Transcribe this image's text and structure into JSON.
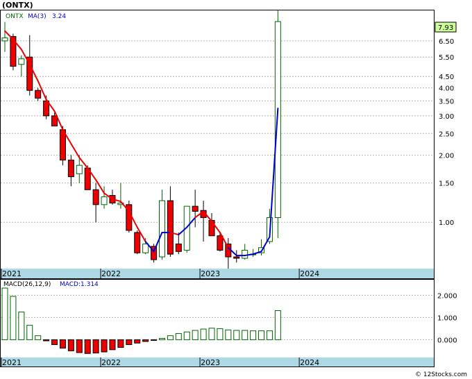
{
  "title": "(ONTX)",
  "watermark": "© 12Stocks.com",
  "price_panel": {
    "ticker_label": "ONTX",
    "ma_label": "MA(3)",
    "ma_value": "3.24",
    "last_price": "7.93"
  },
  "macd_panel": {
    "label": "MACD(26,12,9)",
    "value_label": "MACD:1.314"
  },
  "colors": {
    "up_candle": "#ffffff",
    "up_stroke": "#006400",
    "down_candle": "#ee0000",
    "ma_down": "#ee0000",
    "ma_up": "#0000cc",
    "macd_pos": "#006400",
    "macd_neg": "#ee0000",
    "axis_band": "#add8e6",
    "last_price_box": "#ccff99"
  },
  "chart_data": [
    {
      "type": "candlestick",
      "scale": "log",
      "ylim": [
        0.62,
        8.9
      ],
      "y_ticks": [
        "6.50",
        "5.50",
        "4.50",
        "4.00",
        "3.50",
        "3.00",
        "2.50",
        "2.00",
        "1.50",
        "1.00"
      ],
      "x_tick_labels": [
        "2021",
        "2022",
        "2023",
        "2024"
      ],
      "x_tick_positions": [
        0,
        12,
        24,
        36
      ],
      "candles": [
        {
          "o": 6.5,
          "h": 7.9,
          "l": 5.8,
          "c": 6.7
        },
        {
          "o": 6.8,
          "h": 7.0,
          "l": 4.8,
          "c": 5.0
        },
        {
          "o": 5.1,
          "h": 5.6,
          "l": 4.5,
          "c": 5.4
        },
        {
          "o": 5.5,
          "h": 6.9,
          "l": 3.7,
          "c": 3.9
        },
        {
          "o": 3.9,
          "h": 4.0,
          "l": 3.5,
          "c": 3.6
        },
        {
          "o": 3.5,
          "h": 3.7,
          "l": 2.9,
          "c": 3.0
        },
        {
          "o": 3.0,
          "h": 3.1,
          "l": 2.7,
          "c": 2.7
        },
        {
          "o": 2.6,
          "h": 2.7,
          "l": 1.8,
          "c": 1.9
        },
        {
          "o": 1.9,
          "h": 2.0,
          "l": 1.45,
          "c": 1.6
        },
        {
          "o": 1.65,
          "h": 2.0,
          "l": 1.5,
          "c": 1.8
        },
        {
          "o": 1.75,
          "h": 1.8,
          "l": 1.4,
          "c": 1.4
        },
        {
          "o": 1.4,
          "h": 1.5,
          "l": 1.0,
          "c": 1.2
        },
        {
          "o": 1.2,
          "h": 1.45,
          "l": 1.15,
          "c": 1.3
        },
        {
          "o": 1.32,
          "h": 1.4,
          "l": 1.2,
          "c": 1.22
        },
        {
          "o": 1.2,
          "h": 1.5,
          "l": 1.15,
          "c": 1.22
        },
        {
          "o": 1.2,
          "h": 1.25,
          "l": 0.9,
          "c": 0.92
        },
        {
          "o": 0.9,
          "h": 0.92,
          "l": 0.72,
          "c": 0.73
        },
        {
          "o": 0.73,
          "h": 0.85,
          "l": 0.72,
          "c": 0.8
        },
        {
          "o": 0.78,
          "h": 0.8,
          "l": 0.66,
          "c": 0.68
        },
        {
          "o": 0.7,
          "h": 1.4,
          "l": 0.68,
          "c": 1.25
        },
        {
          "o": 1.25,
          "h": 1.45,
          "l": 0.7,
          "c": 0.72
        },
        {
          "o": 0.8,
          "h": 0.9,
          "l": 0.72,
          "c": 0.74
        },
        {
          "o": 0.75,
          "h": 1.05,
          "l": 0.73,
          "c": 1.18
        },
        {
          "o": 1.18,
          "h": 1.4,
          "l": 0.95,
          "c": 1.12
        },
        {
          "o": 1.13,
          "h": 1.25,
          "l": 0.82,
          "c": 1.05
        },
        {
          "o": 1.02,
          "h": 1.1,
          "l": 0.88,
          "c": 0.87
        },
        {
          "o": 0.87,
          "h": 0.9,
          "l": 0.74,
          "c": 0.75
        },
        {
          "o": 0.8,
          "h": 0.85,
          "l": 0.62,
          "c": 0.7
        },
        {
          "o": 0.7,
          "h": 0.75,
          "l": 0.66,
          "c": 0.69
        },
        {
          "o": 0.69,
          "h": 0.8,
          "l": 0.68,
          "c": 0.75
        },
        {
          "o": 0.72,
          "h": 0.76,
          "l": 0.7,
          "c": 0.72
        },
        {
          "o": 0.73,
          "h": 0.84,
          "l": 0.71,
          "c": 0.77
        },
        {
          "o": 0.82,
          "h": 1.15,
          "l": 0.8,
          "c": 1.05
        },
        {
          "o": 1.05,
          "h": 8.9,
          "l": 0.85,
          "c": 7.93
        }
      ],
      "ma": [
        7.2,
        6.6,
        5.95,
        5.1,
        4.3,
        3.55,
        3.15,
        2.6,
        2.25,
        1.95,
        1.75,
        1.55,
        1.35,
        1.27,
        1.24,
        1.12,
        0.95,
        0.82,
        0.74,
        0.9,
        0.9,
        0.88,
        0.95,
        1.05,
        1.12,
        1.01,
        0.9,
        0.77,
        0.71,
        0.71,
        0.72,
        0.74,
        0.86,
        3.24
      ],
      "ma_trend": [
        "d",
        "d",
        "d",
        "d",
        "d",
        "d",
        "d",
        "d",
        "d",
        "d",
        "d",
        "d",
        "d",
        "d",
        "d",
        "d",
        "d",
        "d",
        "u",
        "u",
        "u",
        "d",
        "u",
        "u",
        "d",
        "d",
        "d",
        "d",
        "u",
        "u",
        "u",
        "u",
        "u",
        "u"
      ]
    },
    {
      "type": "bar",
      "ylim": [
        -0.8,
        2.7
      ],
      "y_ticks": [
        "2.000",
        "1.000",
        "0.000"
      ],
      "y_tick_values": [
        2.0,
        1.0,
        0.0
      ],
      "values": [
        2.75,
        1.95,
        1.25,
        0.65,
        0.18,
        -0.05,
        -0.22,
        -0.38,
        -0.5,
        -0.58,
        -0.62,
        -0.6,
        -0.55,
        -0.45,
        -0.35,
        -0.22,
        -0.15,
        -0.08,
        -0.02,
        0.06,
        0.18,
        0.28,
        0.35,
        0.42,
        0.48,
        0.52,
        0.5,
        0.44,
        0.42,
        0.42,
        0.4,
        0.4,
        0.4,
        1.31
      ]
    }
  ]
}
